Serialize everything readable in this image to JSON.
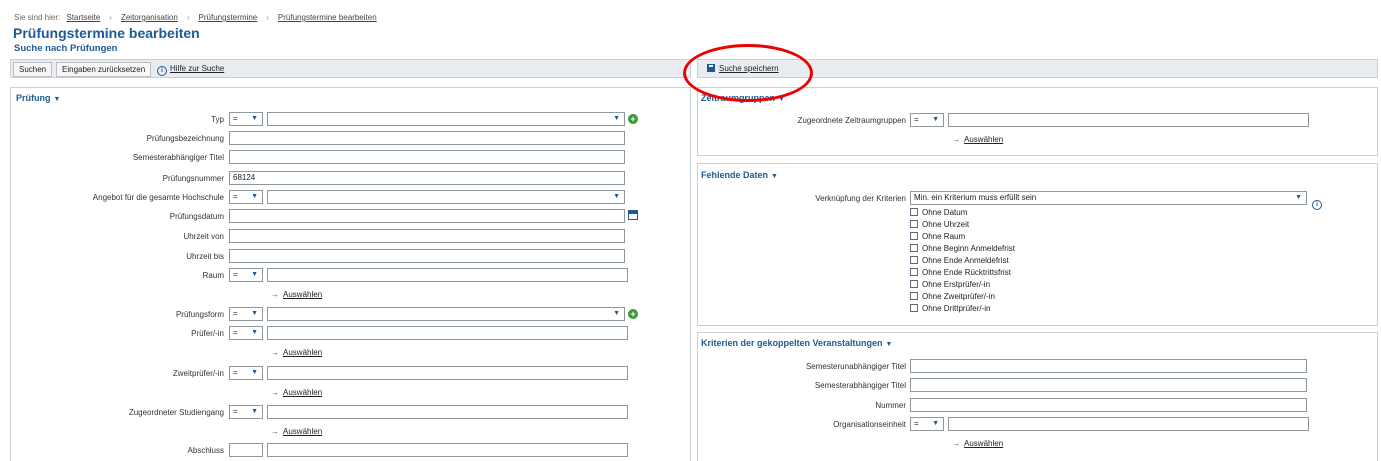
{
  "breadcrumb": {
    "prefix": "Sie sind hier:",
    "items": [
      "Startseite",
      "Zeitorganisation",
      "Prüfungstermine",
      "Prüfungstermine bearbeiten"
    ]
  },
  "page_title": "Prüfungstermine bearbeiten",
  "subtitle": "Suche nach Prüfungen",
  "toolbar": {
    "search": "Suchen",
    "reset": "Eingaben zurücksetzen",
    "help": "Hilfe zur Suche",
    "save_search": "Suche speichern"
  },
  "pruefung": {
    "header": "Prüfung",
    "typ": {
      "label": "Typ",
      "op": "=",
      "value": ""
    },
    "bezeichnung": {
      "label": "Prüfungsbezeichnung",
      "value": ""
    },
    "semtitel": {
      "label": "Semesterabhängiger Titel",
      "value": ""
    },
    "nummer": {
      "label": "Prüfungsnummer",
      "value": "68124"
    },
    "angebot": {
      "label": "Angebot für die gesamte Hochschule",
      "op": "=",
      "value": ""
    },
    "datum": {
      "label": "Prüfungsdatum",
      "value": ""
    },
    "uhrzeit_von": {
      "label": "Uhrzeit von",
      "value": ""
    },
    "uhrzeit_bis": {
      "label": "Uhrzeit bis",
      "value": ""
    },
    "raum": {
      "label": "Raum",
      "op": "=",
      "value": ""
    },
    "pruefungsform": {
      "label": "Prüfungsform",
      "op": "=",
      "value": ""
    },
    "pruefer": {
      "label": "Prüfer/-in",
      "op": "=",
      "value": ""
    },
    "zweitpruefer": {
      "label": "Zweitprüfer/-in",
      "op": "=",
      "value": ""
    },
    "studiengang": {
      "label": "Zugeordneter Studiengang",
      "op": "=",
      "value": ""
    },
    "abschluss": {
      "label": "Abschluss"
    },
    "select_link": "Auswählen"
  },
  "zeitraum": {
    "header": "Zeitraumgruppen",
    "label": "Zugeordnete Zeitraumgruppen",
    "op": "=",
    "value": "",
    "select_link": "Auswählen"
  },
  "fehlend": {
    "header": "Fehlende Daten",
    "verkn_label": "Verknüpfung der Kriterien",
    "verkn_value": "Min. ein Kriterium muss erfüllt sein",
    "options": [
      "Ohne Datum",
      "Ohne Uhrzeit",
      "Ohne Raum",
      "Ohne Beginn Anmeldefrist",
      "Ohne Ende Anmeldefrist",
      "Ohne Ende Rücktrittsfrist",
      "Ohne Erstprüfer/-in",
      "Ohne Zweitprüfer/-in",
      "Ohne Drittprüfer/-in"
    ]
  },
  "kriterien": {
    "header": "Kriterien der gekoppelten Veranstaltungen",
    "semunabh": {
      "label": "Semesterunabhängiger Titel",
      "value": ""
    },
    "semabh": {
      "label": "Semesterabhängiger Titel",
      "value": ""
    },
    "nummer": {
      "label": "Nummer",
      "value": ""
    },
    "orgeinheit": {
      "label": "Organisationseinheit",
      "op": "=",
      "value": ""
    },
    "select_link": "Auswählen"
  },
  "annotation_color": "#ee0000"
}
